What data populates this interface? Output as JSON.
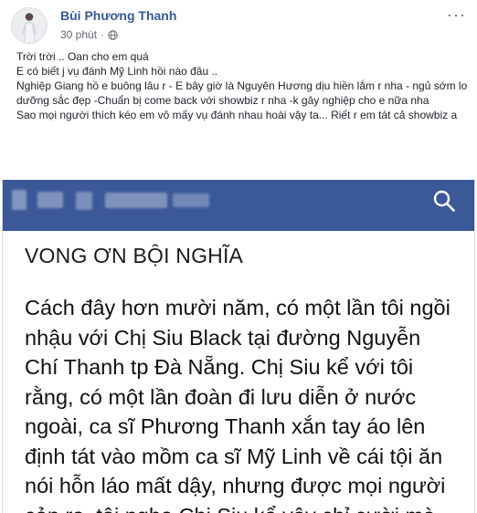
{
  "post": {
    "author": "Bùi Phương Thanh",
    "time": "30 phút",
    "privacy_icon": "globe-icon",
    "more_icon": "more-options-icon",
    "more_label": "···",
    "caption_lines": [
      "Trời trời .. Oan cho em quá",
      "E có biết j vụ đánh Mỹ Linh hồi nào đâu ..",
      "Nghiệp Giang hồ e buông lâu r - E bây giờ là Nguyên Hương dịu hiền lắm r nha - ngủ sớm lo dưỡng sắc đẹp -Chuẩn bị come back với showbiz r nha -k gây nghiệp cho e nữa nha",
      "Sao mọi người thích kéo em vô mấy vụ đánh nhau hoài vậy ta... Riết r em tát cả showbiz a"
    ]
  },
  "screenshot": {
    "header_color": "#3b5998",
    "search_icon": "search-icon",
    "title": "VONG ƠN BỘI NGHĨA",
    "body_lines": [
      "Cách đây hơn mười năm, có một lần tôi ngồi",
      "nhậu với Chị Siu Black tại đường Nguyễn",
      "Chí Thanh tp Đà Nẵng. Chị Siu kể với tôi",
      "rằng, có một lần đoàn đi lưu diễn ở nước",
      "ngoài, ca sĩ Phương Thanh xắn tay áo lên",
      "định tát vào mồm ca sĩ Mỹ Linh về cái tội ăn",
      "nói hỗn láo mất dậy, nhưng được mọi người",
      "cản ra, tôi nghe Chị Siu kể vậy chỉ cười mà"
    ]
  }
}
